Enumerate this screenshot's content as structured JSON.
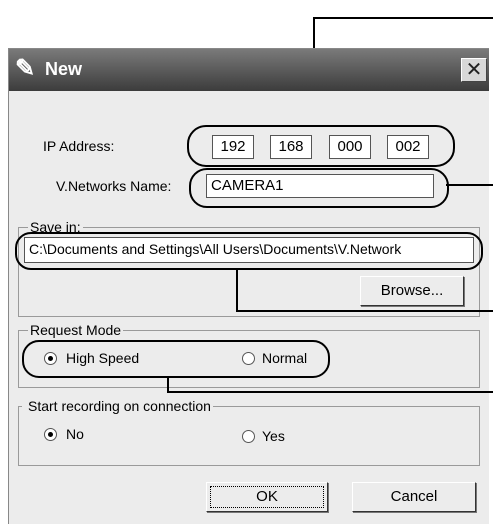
{
  "window": {
    "title": "New",
    "close_glyph": "✕",
    "app_icon": "✎"
  },
  "ip": {
    "label": "IP Address:",
    "octets": [
      "192",
      "168",
      "000",
      "002"
    ]
  },
  "name": {
    "label": "V.Networks Name:",
    "value": "CAMERA1"
  },
  "save": {
    "group_label": "Save in:",
    "path": "C:\\Documents and Settings\\All Users\\Documents\\V.Network",
    "browse_label": "Browse..."
  },
  "request": {
    "group_label": "Request Mode",
    "high_speed_label": "High Speed",
    "normal_label": "Normal",
    "selected": "High Speed"
  },
  "recording": {
    "group_label": "Start recording on connection",
    "no_label": "No",
    "yes_label": "Yes",
    "selected": "No"
  },
  "buttons": {
    "ok_label": "OK",
    "cancel_label": "Cancel"
  }
}
